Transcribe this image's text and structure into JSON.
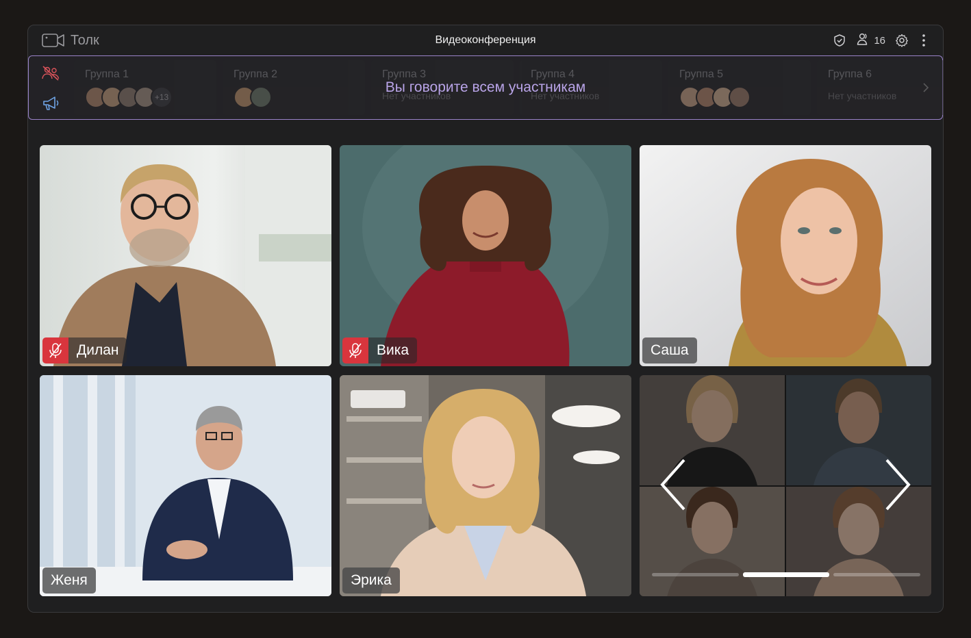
{
  "app": {
    "name": "Толк",
    "window_title": "Видеоконференция",
    "participants_count": "16"
  },
  "groups": [
    {
      "name": "Группа 1",
      "status": "",
      "more": "+13"
    },
    {
      "name": "Группа 2",
      "status": "",
      "more": ""
    },
    {
      "name": "Группа 3",
      "status": "Нет участников",
      "more": ""
    },
    {
      "name": "Группа 4",
      "status": "Нет участников",
      "more": ""
    },
    {
      "name": "Группа 5",
      "status": "",
      "more": ""
    },
    {
      "name": "Группа 6",
      "status": "Нет участников",
      "more": ""
    }
  ],
  "banner": "Вы говорите всем участникам",
  "participants": [
    {
      "name": "Дилан",
      "muted": true
    },
    {
      "name": "Вика",
      "muted": true
    },
    {
      "name": "Саша",
      "muted": false
    },
    {
      "name": "Женя",
      "muted": false
    },
    {
      "name": "Эрика",
      "muted": false
    }
  ],
  "overflow_tile": {
    "pages": 3,
    "current_page": 2
  },
  "colors": {
    "accent": "#9a83c9",
    "banner_text": "#b9a4e8",
    "mute_red": "#d9353d",
    "background": "#1b1816"
  },
  "icons": {
    "logo": "video-camera-icon",
    "security": "shield-check-icon",
    "participants": "people-icon",
    "settings": "gear-icon",
    "menu": "more-vertical-icon",
    "groups_toggle": "groups-off-icon",
    "broadcast": "megaphone-icon",
    "muted": "mic-off-icon"
  }
}
